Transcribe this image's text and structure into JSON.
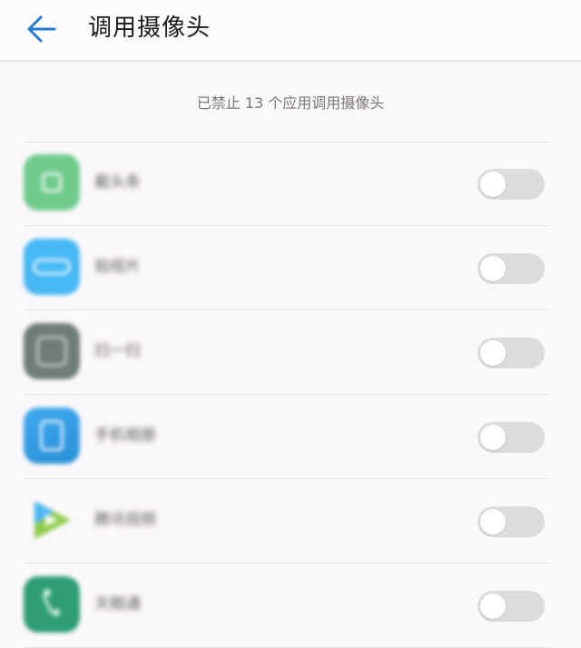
{
  "header": {
    "title": "调用摄像头",
    "back_icon": "back-arrow-icon",
    "accent": "#2a7ad8"
  },
  "summary": "已禁止 13 个应用调用摄像头",
  "apps": [
    {
      "name": "截头条",
      "icon_color": "#6fcb8c",
      "enabled": false
    },
    {
      "name": "拍视片",
      "icon_color": "#46b8f3",
      "enabled": false
    },
    {
      "name": "扫一扫",
      "icon_color": "#6f7d78",
      "enabled": false
    },
    {
      "name": "手机相册",
      "icon_color": "#2f9ee6",
      "enabled": false
    },
    {
      "name": "腾讯视频",
      "icon_color": "#f5c04a",
      "enabled": false
    },
    {
      "name": "天眼通",
      "icon_color": "#2f9e74",
      "enabled": false
    }
  ]
}
